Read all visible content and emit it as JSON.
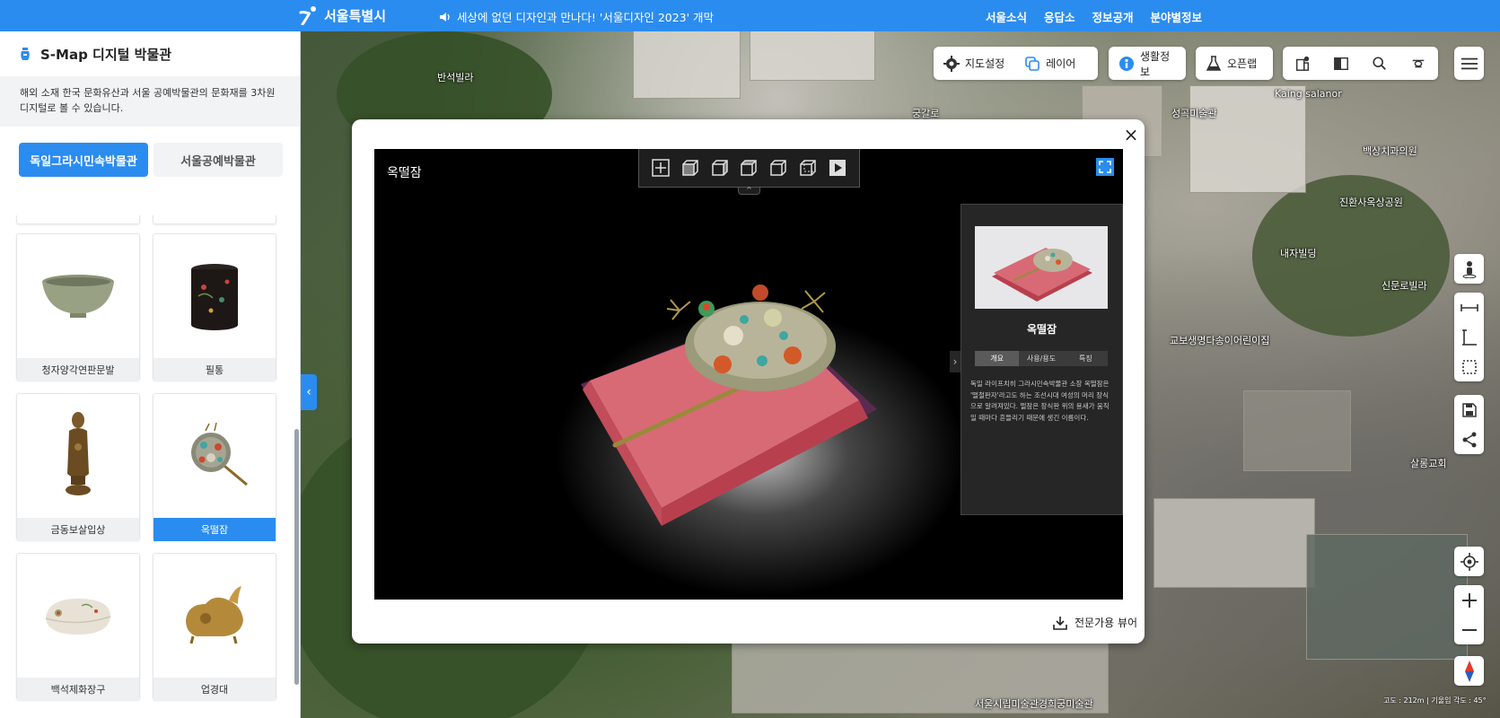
{
  "topbar": {
    "brand": "서울특별시",
    "notice": "세상에 없던 디자인과 만나다! '서울디자인 2023' 개막",
    "links": [
      "서울소식",
      "응답소",
      "정보공개",
      "분야별정보"
    ]
  },
  "sidebar": {
    "title": "S-Map 디지털 박물관",
    "description": "해외 소재 한국 문화유산과 서울 공예박물관의 문화재를 3차원 디지털로 볼 수 있습니다.",
    "tabs": [
      {
        "label": "독일그라시민속박물관",
        "active": true
      },
      {
        "label": "서울공예박물관",
        "active": false
      }
    ],
    "items": [
      {
        "label": "청자양각연판문발",
        "icon": "celadon-bowl"
      },
      {
        "label": "필통",
        "icon": "brush-holder"
      },
      {
        "label": "금동보살입상",
        "icon": "bodhisattva-statue"
      },
      {
        "label": "옥떨잠",
        "icon": "hairpin",
        "selected": true
      },
      {
        "label": "백석제화장구",
        "icon": "cosmetic-case"
      },
      {
        "label": "업경대",
        "icon": "mirror-stand"
      }
    ]
  },
  "toolbar": {
    "map_settings": "지도설정",
    "layer": "레이어",
    "life_info": "생활정보",
    "open_lab": "오픈랩"
  },
  "map": {
    "labels": [
      "반석빌라",
      "궁갈로",
      "성곡미술관",
      "Kaing salanor",
      "백상치과의원",
      "진환사옥상공원",
      "내자빌딩",
      "신문로빌라",
      "교보생명다송이어린이집",
      "살롱교회",
      "서울시립미술관경희궁미술관"
    ],
    "scale_text": "고도 : 212m | 기울임 각도 : 45°"
  },
  "viewer": {
    "title": "옥떨잠",
    "info": {
      "title": "옥떨잠",
      "tabs": [
        "개요",
        "사용/용도",
        "특징"
      ],
      "active_tab": "개요",
      "text": "독일 라이프치히 그라시민속박물관 소장 옥떨잠은 '떨철판자'라고도 하는 조선시대 여성의 머리 장식으로 알려져있다. 떨잠은 장식판 위의 용새가 움직일 때마다 흔들리기 때문에 생긴 이름이다."
    },
    "expert_viewer": "전문가용 뷰어",
    "view_modes": [
      "fit-view",
      "front-view",
      "side-view",
      "top-view",
      "back-view",
      "bottom-view",
      "play"
    ]
  },
  "colors": {
    "accent": "#2b8cf0",
    "viewer_bg": "#000000",
    "panel_bg": "#262626"
  }
}
